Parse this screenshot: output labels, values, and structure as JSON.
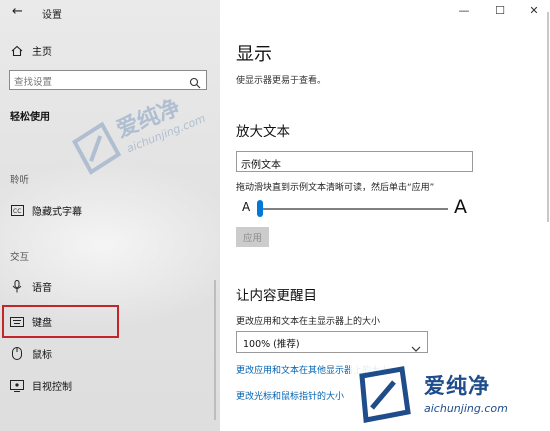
{
  "window": {
    "title": "设置",
    "controls": [
      "—",
      "☐",
      "✕"
    ]
  },
  "sidebar": {
    "home_label": "主页",
    "search_placeholder": "查找设置",
    "section_title": "轻松使用",
    "group_hearing": "聆听",
    "item_captions": "隐藏式字幕",
    "group_interaction": "交互",
    "item_speech": "语音",
    "item_keyboard": "键盘",
    "item_mouse": "鼠标",
    "item_eye_control": "目视控制"
  },
  "main": {
    "title": "显示",
    "description": "使显示器更易于查看。",
    "enlarge_text_heading": "放大文本",
    "sample_text": "示例文本",
    "slider_hint": "拖动滑块直到示例文本清晰可读，然后单击“应用”",
    "slider_min_label": "A",
    "slider_max_label": "A",
    "slider_value_fraction": 0.0,
    "apply_label": "应用",
    "bigger_heading": "让内容更醒目",
    "scale_label": "更改应用和文本在主显示器上的大小",
    "scale_value": "100% (推荐)",
    "link_other_display": "更改应用和文本在其他显示器上的大小",
    "link_pointer": "更改光标和鼠标指针的大小"
  },
  "watermark": {
    "big": "爱纯净",
    "small": "aichunjing.com"
  },
  "colors": {
    "accent": "#0078d7",
    "link": "#0063b1",
    "highlight_frame": "#c0262b",
    "watermark": "#1f4c8a"
  },
  "icons": {
    "back": "back-arrow-icon",
    "home": "home-icon",
    "search": "search-icon",
    "captions": "closed-captions-icon",
    "speech": "microphone-icon",
    "keyboard": "keyboard-icon",
    "mouse": "mouse-icon",
    "eye_control": "eye-control-icon",
    "chevron": "chevron-down-icon"
  }
}
